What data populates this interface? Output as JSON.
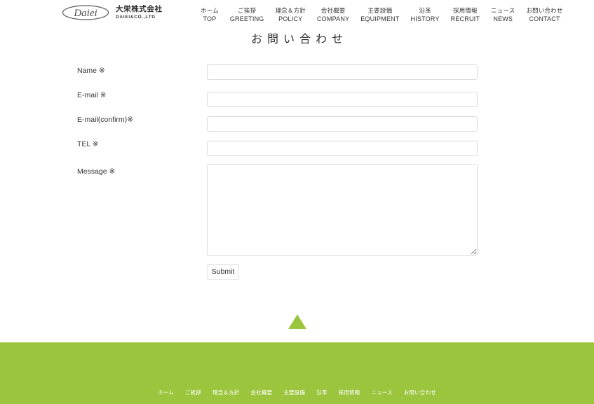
{
  "header": {
    "logo_text": "Daiei",
    "company_jp": "大栄株式会社",
    "company_en": "DAIEI&CO.,LTD",
    "nav": [
      {
        "jp": "ホーム",
        "en": "TOP"
      },
      {
        "jp": "ご挨拶",
        "en": "GREETING"
      },
      {
        "jp": "理念＆方針",
        "en": "POLICY"
      },
      {
        "jp": "会社概要",
        "en": "COMPANY"
      },
      {
        "jp": "主要設備",
        "en": "EQUIPMENT"
      },
      {
        "jp": "沿革",
        "en": "HISTORY"
      },
      {
        "jp": "採用情報",
        "en": "RECRUIT"
      },
      {
        "jp": "ニュース",
        "en": "NEWS"
      },
      {
        "jp": "お問い合わせ",
        "en": "CONTACT"
      }
    ]
  },
  "main": {
    "title": "お問い合わせ",
    "fields": [
      {
        "label": "Name ※",
        "value": "",
        "placeholder": "",
        "type": "text"
      },
      {
        "label": "E-mail ※",
        "value": "",
        "placeholder": "",
        "type": "text"
      },
      {
        "label": "E-mail(confirm)※",
        "value": "",
        "placeholder": "",
        "type": "text"
      },
      {
        "label": "TEL ※",
        "value": "",
        "placeholder": "",
        "type": "text"
      },
      {
        "label": "Message ※",
        "value": "",
        "placeholder": "",
        "type": "textarea"
      }
    ],
    "submit_label": "Submit"
  },
  "scroll_top": {
    "icon": "triangle-up-icon"
  },
  "footer": {
    "background_color": "#9BC53D",
    "links": [
      "ホーム",
      "ご挨拶",
      "理念＆方針",
      "会社概要",
      "主要設備",
      "沿革",
      "採用情報",
      "ニュース",
      "お問い合わせ"
    ]
  }
}
